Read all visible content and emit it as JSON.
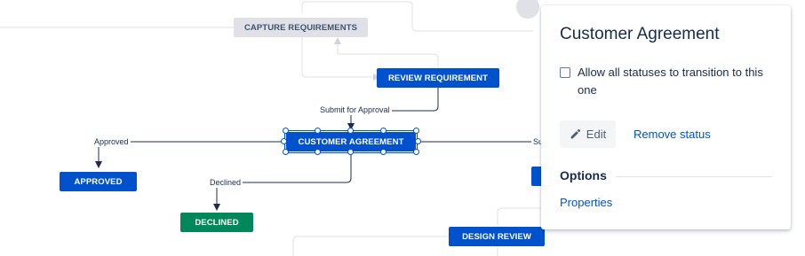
{
  "workflow": {
    "statuses": {
      "capture_requirements": "CAPTURE REQUIREMENTS",
      "review_requirement": "REVIEW REQUIREMENT",
      "customer_agreement": "CUSTOMER AGREEMENT",
      "approved": "APPROVED",
      "declined": "DECLINED",
      "design_review": "DESIGN REVIEW"
    },
    "transitions": {
      "submit_for_approval": "Submit for Approval",
      "approved": "Approved",
      "declined": "Declined",
      "partial_right": "Su"
    }
  },
  "panel": {
    "title": "Customer Agreement",
    "allow_all_label": "Allow all statuses to transition to this one",
    "allow_all_checked": false,
    "edit_label": "Edit",
    "remove_label": "Remove status",
    "options_heading": "Options",
    "properties_label": "Properties"
  },
  "colors": {
    "primary": "#0052cc",
    "success": "#00875a",
    "neutral": "#dfe1e6",
    "text": "#172b4d",
    "connector": "#1d2b4f",
    "faint_connector": "#dfe1e6"
  },
  "icons": {
    "edit": "pencil-icon"
  }
}
